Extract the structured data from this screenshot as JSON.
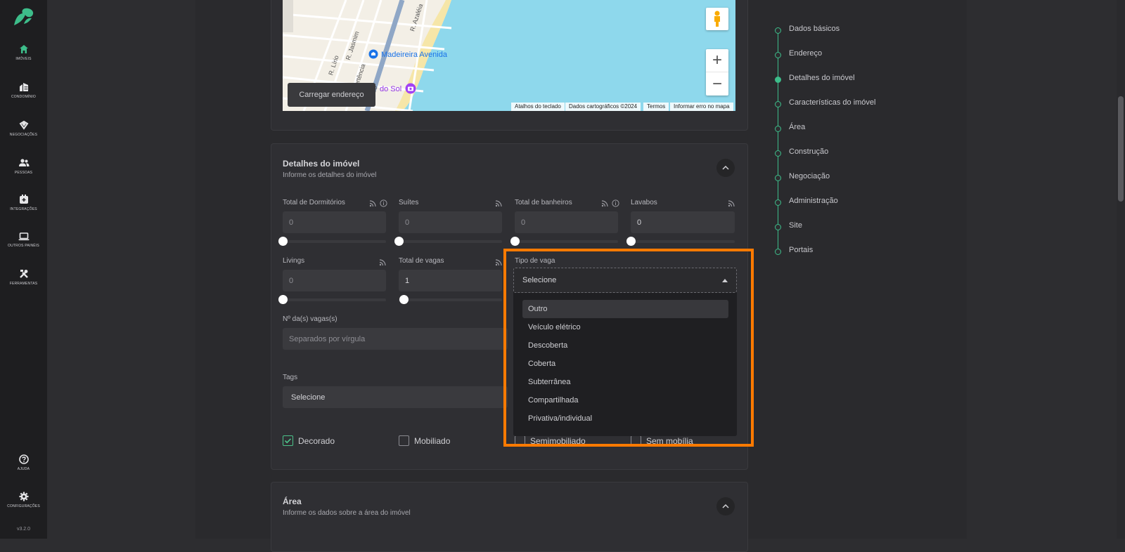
{
  "sidebar": {
    "items": [
      {
        "label": "Imóveis",
        "icon": "home-icon"
      },
      {
        "label": "Condomínio",
        "icon": "building-icon"
      },
      {
        "label": "Negociações",
        "icon": "handshake-icon"
      },
      {
        "label": "Pessoas",
        "icon": "people-icon"
      },
      {
        "label": "Integrações",
        "icon": "integration-icon"
      },
      {
        "label": "Outros painéis",
        "icon": "laptop-icon"
      },
      {
        "label": "Ferramentas",
        "icon": "tools-icon"
      }
    ],
    "help": "Ajuda",
    "settings": "Configurações",
    "version": "v3.2.0"
  },
  "map": {
    "streets": [
      "R. Azaléia",
      "R. Jasmim",
      "R. Lírio",
      "R. Hortência",
      "Oliveiro"
    ],
    "place": "Madeireira Avenida",
    "place2": "do Sol",
    "load_button": "Carregar endereço",
    "attribution": [
      "Atalhos do teclado",
      "Dados cartográficos ©2024",
      "Termos",
      "Informar erro no mapa"
    ],
    "zoom_in": "+",
    "zoom_out": "−"
  },
  "details": {
    "title": "Detalhes do imóvel",
    "subtitle": "Informe os detalhes do imóvel",
    "fields": {
      "dormitorios": {
        "label": "Total de Dormitórios",
        "placeholder": "0"
      },
      "suites": {
        "label": "Suítes",
        "placeholder": "0"
      },
      "banheiros": {
        "label": "Total de banheiros",
        "placeholder": "0"
      },
      "lavabos": {
        "label": "Lavabos",
        "value": "0"
      },
      "livings": {
        "label": "Livings",
        "placeholder": "0"
      },
      "vagas": {
        "label": "Total de vagas",
        "value": "1"
      },
      "tipo_vaga": {
        "label": "Tipo de vaga",
        "value": "Selecione"
      },
      "num_vagas": {
        "label": "Nº da(s) vagas(s)",
        "placeholder": "Separados por vírgula"
      },
      "tags": {
        "label": "Tags",
        "value": "Selecione"
      }
    },
    "checkboxes": [
      {
        "label": "Decorado",
        "checked": true
      },
      {
        "label": "Mobiliado",
        "checked": false
      },
      {
        "label": "Semimobiliado",
        "checked": false
      },
      {
        "label": "Sem mobília",
        "checked": false
      }
    ]
  },
  "dropdown": {
    "options": [
      "Outro",
      "Veículo elétrico",
      "Descoberta",
      "Coberta",
      "Subterrânea",
      "Compartilhada",
      "Privativa/individual"
    ],
    "highlighted": "Outro"
  },
  "area": {
    "title": "Área",
    "subtitle": "Informe os dados sobre a área do imóvel"
  },
  "steps": [
    {
      "label": "Dados básicos",
      "active": false
    },
    {
      "label": "Endereço",
      "active": false
    },
    {
      "label": "Detalhes do imóvel",
      "active": true
    },
    {
      "label": "Características do imóvel",
      "active": false
    },
    {
      "label": "Área",
      "active": false
    },
    {
      "label": "Construção",
      "active": false
    },
    {
      "label": "Negociação",
      "active": false
    },
    {
      "label": "Administração",
      "active": false
    },
    {
      "label": "Site",
      "active": false
    },
    {
      "label": "Portais",
      "active": false
    }
  ],
  "colors": {
    "accent": "#3dbd8a",
    "highlight": "#ff7a00"
  }
}
